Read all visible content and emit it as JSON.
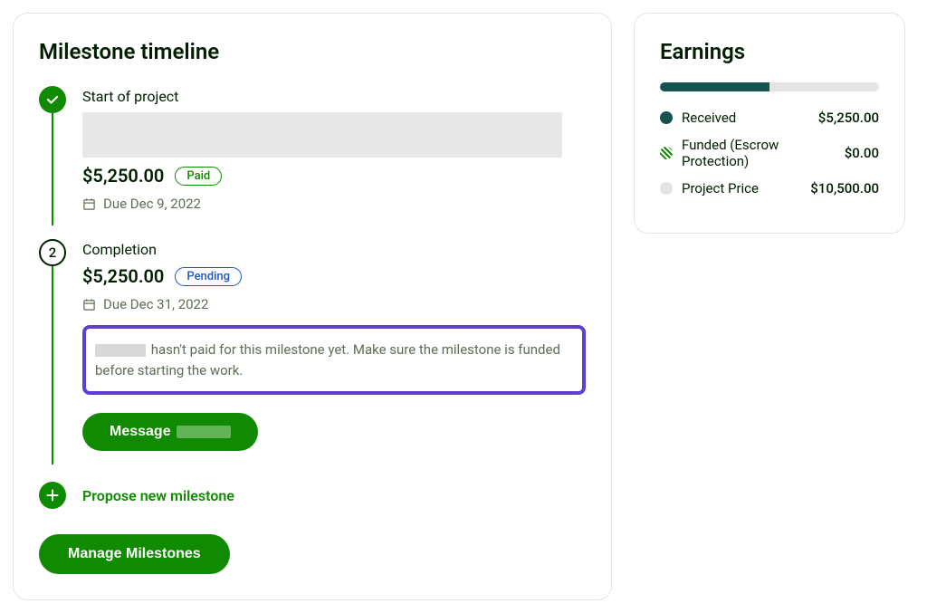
{
  "timeline": {
    "title": "Milestone timeline",
    "milestones": [
      {
        "name": "Start of project",
        "amount": "$5,250.00",
        "status": "Paid",
        "due": "Due Dec 9, 2022"
      },
      {
        "step": "2",
        "name": "Completion",
        "amount": "$5,250.00",
        "status": "Pending",
        "due": "Due Dec 31, 2022",
        "warning": "hasn't paid for this milestone yet. Make sure the milestone is funded before starting the work."
      }
    ],
    "message_btn": "Message",
    "propose_label": "Propose new milestone",
    "manage_btn": "Manage Milestones"
  },
  "earnings": {
    "title": "Earnings",
    "rows": [
      {
        "label": "Received",
        "value": "$5,250.00"
      },
      {
        "label": "Funded (Escrow Protection)",
        "value": "$0.00"
      },
      {
        "label": "Project Price",
        "value": "$10,500.00"
      }
    ]
  }
}
